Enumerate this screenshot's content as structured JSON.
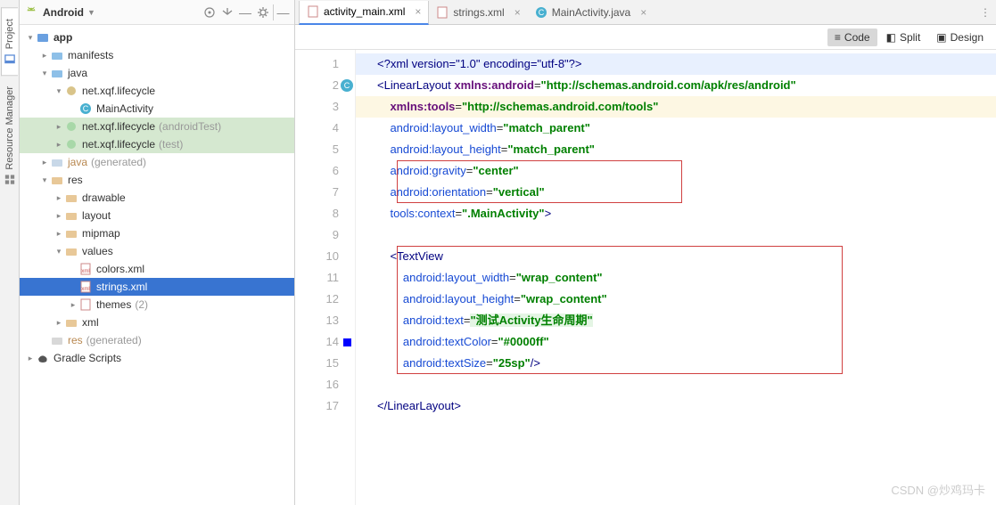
{
  "left_tabs": {
    "project": "Project",
    "resource_manager": "Resource Manager"
  },
  "project_header": {
    "title": "Android"
  },
  "tree": {
    "app": "app",
    "manifests": "manifests",
    "java": "java",
    "pkg1": "net.xqf.lifecycle",
    "mainactivity": "MainActivity",
    "pkg2": "net.xqf.lifecycle",
    "pkg2_suffix": "(androidTest)",
    "pkg3": "net.xqf.lifecycle",
    "pkg3_suffix": "(test)",
    "java_gen": "java",
    "java_gen_suffix": "(generated)",
    "res": "res",
    "drawable": "drawable",
    "layout": "layout",
    "mipmap": "mipmap",
    "values": "values",
    "colors": "colors.xml",
    "strings": "strings.xml",
    "themes": "themes",
    "themes_suffix": "(2)",
    "xml": "xml",
    "res_gen": "res",
    "res_gen_suffix": "(generated)",
    "gradle": "Gradle Scripts"
  },
  "tabs": {
    "t1": "activity_main.xml",
    "t2": "strings.xml",
    "t3": "MainActivity.java"
  },
  "mode": {
    "code": "Code",
    "split": "Split",
    "design": "Design"
  },
  "code": {
    "line1": "<?xml version=\"1.0\" encoding=\"utf-8\"?>",
    "line2_a": "<LinearLayout ",
    "line2_ns": "xmlns:android",
    "line2_eq": "=",
    "line2_v": "\"http://schemas.android.com/apk/res/android\"",
    "line3_ns": "xmlns:tools",
    "line3_eq": "=",
    "line3_v": "\"http://schemas.android.com/tools\"",
    "line4_a": "android:layout_width",
    "line4_v": "\"match_parent\"",
    "line5_a": "android:layout_height",
    "line5_v": "\"match_parent\"",
    "line6_a": "android:gravity",
    "line6_v": "\"center\"",
    "line7_a": "android:orientation",
    "line7_v": "\"vertical\"",
    "line8_a": "tools:context",
    "line8_v": "\".MainActivity\"",
    "line8_end": ">",
    "line10": "<TextView",
    "line11_a": "android:layout_width",
    "line11_v": "\"wrap_content\"",
    "line12_a": "android:layout_height",
    "line12_v": "\"wrap_content\"",
    "line13_a": "android:text",
    "line13_v": "\"测试Activity生命周期\"",
    "line14_a": "android:textColor",
    "line14_v": "\"#0000ff\"",
    "line15_a": "android:textSize",
    "line15_v": "\"25sp\"",
    "line15_end": "/>",
    "line17": "</LinearLayout>"
  },
  "gutter_lines": [
    "1",
    "2",
    "3",
    "4",
    "5",
    "6",
    "7",
    "8",
    "9",
    "10",
    "11",
    "12",
    "13",
    "14",
    "15",
    "16",
    "17"
  ],
  "watermark": "CSDN @炒鸡玛卡"
}
